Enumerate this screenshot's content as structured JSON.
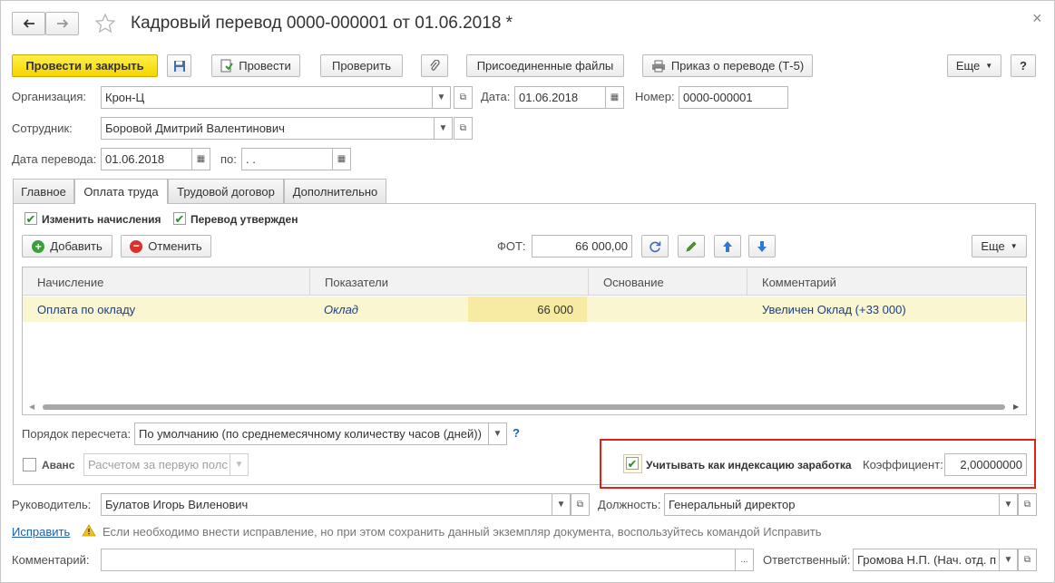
{
  "window": {
    "title": "Кадровый перевод 0000-000001 от 01.06.2018 *",
    "back_icon": "arrow-left",
    "forward_icon": "arrow-right",
    "favorite_icon": "star",
    "close_glyph": "×"
  },
  "toolbar": {
    "post_close_label": "Провести и закрыть",
    "post_label": "Провести",
    "check_label": "Проверить",
    "attached_files_label": "Присоединенные файлы",
    "order_label": "Приказ о переводе (Т-5)",
    "more_label": "Еще",
    "help_label": "?"
  },
  "header": {
    "organization_label": "Организация:",
    "organization_value": "Крон-Ц",
    "date_label": "Дата:",
    "date_value": "01.06.2018",
    "number_label": "Номер:",
    "number_value": "0000-000001",
    "employee_label": "Сотрудник:",
    "employee_value": "Боровой Дмитрий Валентинович",
    "transfer_date_label": "Дата перевода:",
    "transfer_date_value": "01.06.2018",
    "to_label": "по:",
    "to_value": " .  ."
  },
  "tabs": [
    {
      "label": "Главное",
      "active": false
    },
    {
      "label": "Оплата труда",
      "active": true
    },
    {
      "label": "Трудовой договор",
      "active": false
    },
    {
      "label": "Дополнительно",
      "active": false
    }
  ],
  "pay": {
    "change_accruals_label": "Изменить начисления",
    "change_accruals_checked": true,
    "approved_label": "Перевод утвержден",
    "approved_checked": true,
    "add_label": "Добавить",
    "cancel_label": "Отменить",
    "fot_label": "ФОТ:",
    "fot_value": "66 000,00",
    "more_label": "Еще"
  },
  "table": {
    "columns": [
      "Начисление",
      "Показатели",
      "Основание",
      "Комментарий"
    ],
    "rows": [
      {
        "accrual": "Оплата по окладу",
        "indicator": "Оклад",
        "value": "66 000",
        "basis": "",
        "comment": "Увеличен Оклад (+33 000)"
      }
    ]
  },
  "recalc": {
    "label": "Порядок пересчета:",
    "value": "По умолчанию (по среднемесячному количеству часов (дней))",
    "help": "?"
  },
  "advance": {
    "label": "Аванс",
    "checked": false,
    "value": "Расчетом за первую полс"
  },
  "indexation": {
    "label": "Учитывать как индексацию заработка",
    "checked": true,
    "coef_label": "Коэффициент:",
    "coef_value": "2,00000000",
    "highlight_color": "#e0201d"
  },
  "footer": {
    "manager_label": "Руководитель:",
    "manager_value": "Булатов Игорь Виленович",
    "position_label": "Должность:",
    "position_value": "Генеральный директор",
    "fix_link": "Исправить",
    "warning_text": "Если необходимо внести исправление, но при этом сохранить данный экземпляр документа, воспользуйтесь командой Исправить",
    "comment_label": "Комментарий:",
    "comment_value": "",
    "comment_button": "...",
    "responsible_label": "Ответственный:",
    "responsible_value": "Громова Н.П. (Нач. отд. п"
  },
  "colors": {
    "accent_yellow": "#f5d400",
    "selected_row": "#fbf6d2",
    "value_cell": "#f7eaa2",
    "link_blue": "#1c5fb0"
  }
}
